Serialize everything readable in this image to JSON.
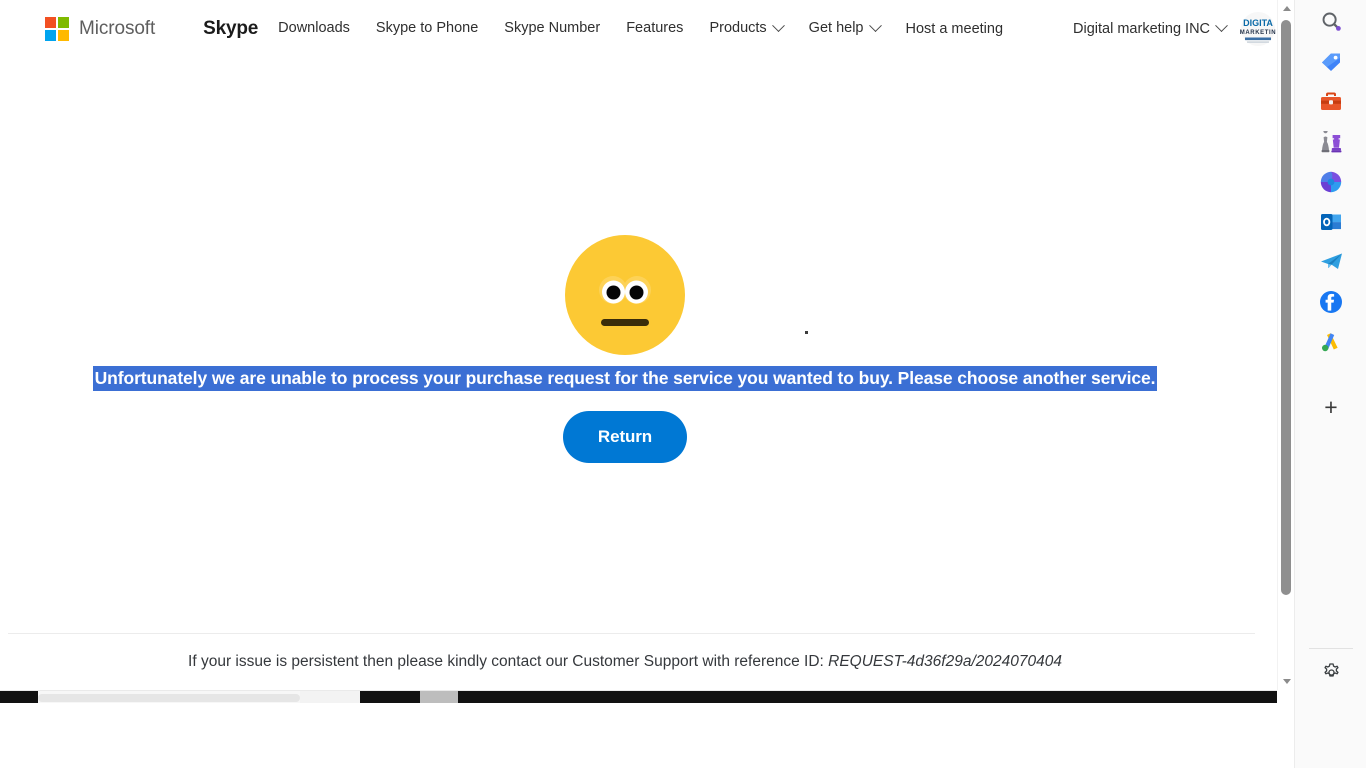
{
  "header": {
    "microsoft_label": "Microsoft",
    "product_label": "Skype",
    "nav_items": [
      {
        "label": "Downloads",
        "has_caret": false
      },
      {
        "label": "Skype to Phone",
        "has_caret": false
      },
      {
        "label": "Skype Number",
        "has_caret": false
      },
      {
        "label": "Features",
        "has_caret": false
      },
      {
        "label": "Products",
        "has_caret": true
      },
      {
        "label": "Get help",
        "has_caret": true
      }
    ],
    "host_meeting_label": "Host a meeting",
    "account_label": "Digital marketing INC",
    "org_logo_line1": "DIGITA",
    "org_logo_line2": "MARKETIN",
    "ms_logo_colors": [
      "#f25022",
      "#7fba00",
      "#00a4ef",
      "#ffb900"
    ]
  },
  "main": {
    "emoji_name": "neutral-face-emoji",
    "emoji_face_color": "#fcc934",
    "emoji_eye_white": "#ffffff",
    "emoji_pupil_color": "#000000",
    "emoji_mouth_color": "#3a2c0a",
    "error_message": "Unfortunately we are unable to process your purchase request for the service you wanted to buy. Please choose another service.",
    "error_highlight_color": "#3b6fd4",
    "error_text_color": "#ffffff",
    "return_button_label": "Return",
    "return_button_color": "#0078d4"
  },
  "footer": {
    "text_prefix": "If your issue is persistent then please kindly contact our Customer Support with reference ID: ",
    "reference_id": "REQUEST-4d36f29a/2024070404"
  },
  "scrollbars": {
    "vertical_thumb_position": "near-top",
    "horizontal_thumb_position": "left"
  },
  "sidebar": {
    "items": [
      {
        "name": "search-icon",
        "label": "Search"
      },
      {
        "name": "tag-icon",
        "label": "Tag"
      },
      {
        "name": "toolbox-icon",
        "label": "Toolbox"
      },
      {
        "name": "chess-pieces-icon",
        "label": "Chess"
      },
      {
        "name": "microsoft-365-icon",
        "label": "Microsoft 365"
      },
      {
        "name": "outlook-icon",
        "label": "Outlook"
      },
      {
        "name": "telegram-icon",
        "label": "Telegram"
      },
      {
        "name": "facebook-icon",
        "label": "Facebook"
      },
      {
        "name": "google-ads-icon",
        "label": "Google Ads"
      }
    ],
    "add_button_label": "+",
    "settings_label": "Settings"
  }
}
